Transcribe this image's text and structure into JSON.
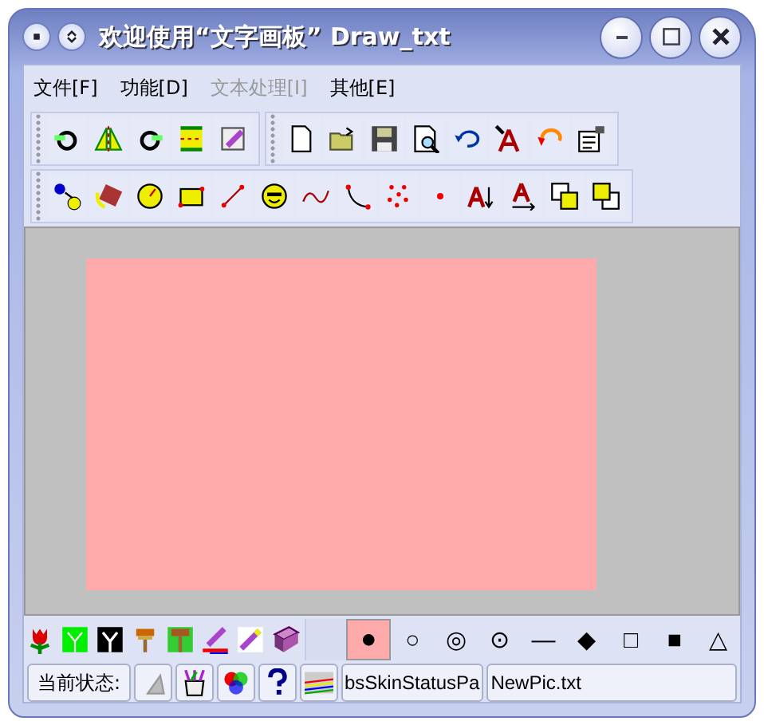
{
  "window": {
    "title": "欢迎使用“文字画板” Draw_txt"
  },
  "menu": [
    {
      "label": "文件[F]",
      "disabled": false
    },
    {
      "label": "功能[D]",
      "disabled": false
    },
    {
      "label": "文本处理[I]",
      "disabled": true
    },
    {
      "label": "其他[E]",
      "disabled": false
    }
  ],
  "shapes": [
    {
      "symbol": "●",
      "selected": true
    },
    {
      "symbol": "○",
      "selected": false
    },
    {
      "symbol": "◎",
      "selected": false
    },
    {
      "symbol": "⊙",
      "selected": false
    },
    {
      "symbol": "—",
      "selected": false
    },
    {
      "symbol": "◆",
      "selected": false
    },
    {
      "symbol": "□",
      "selected": false
    },
    {
      "symbol": "■",
      "selected": false
    },
    {
      "symbol": "△",
      "selected": false
    }
  ],
  "status_bar": {
    "label": "当前状态:",
    "panel_text": "bsSkinStatusPa",
    "file": "NewPic.txt"
  }
}
